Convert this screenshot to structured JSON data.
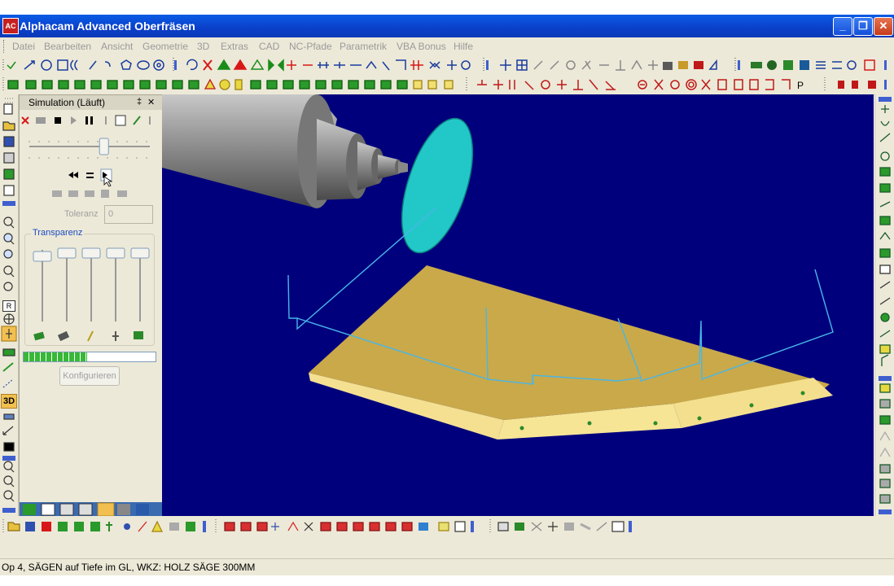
{
  "window": {
    "app_icon_text": "AC",
    "title": "Alphacam Advanced Oberfräsen",
    "minimize": "_",
    "maximize": "❐",
    "close": "✕"
  },
  "menu": {
    "items": [
      "Datei",
      "Bearbeiten",
      "Ansicht",
      "Geometrie",
      "3D",
      "Extras",
      "CAD",
      "NC-Pfade",
      "Parametrik",
      "VBA Bonus",
      "Hilfe"
    ]
  },
  "simulation_panel": {
    "title": "Simulation (Läuft)",
    "pin": "‡",
    "close": "✕",
    "tolerance_label": "Toleranz",
    "tolerance_value": "0",
    "transparency_label": "Transparenz",
    "progress_fraction": 0.48,
    "configure_button": "Konfigurieren",
    "speed_slider_fraction": 0.62
  },
  "left_toolbar": {
    "badge_3d": "3D",
    "badge_r": "R"
  },
  "status": {
    "text": "Op 4, SÄGEN auf Tiefe im GL, WKZ: HOLZ SÄGE 300MM"
  },
  "colors": {
    "viewport_bg": "#00007d",
    "workpiece": "#c9a94a",
    "saw_blade": "#2ec4c4",
    "toolpath": "#49b6e8"
  }
}
